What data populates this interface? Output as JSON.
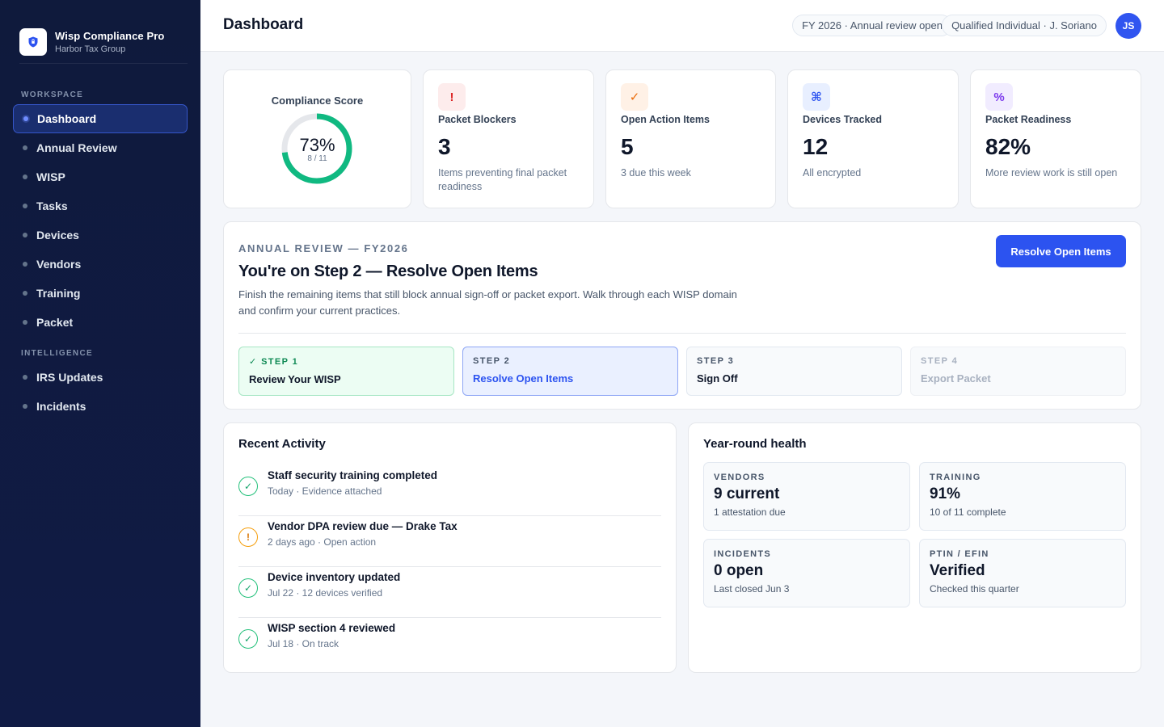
{
  "brand": {
    "name": "Wisp Compliance Pro",
    "org": "Harbor Tax Group"
  },
  "sidebar": {
    "workspace_label": "WORKSPACE",
    "intelligence_label": "INTELLIGENCE",
    "items": [
      {
        "label": "Dashboard",
        "active": true
      },
      {
        "label": "Annual Review"
      },
      {
        "label": "WISP"
      },
      {
        "label": "Tasks"
      },
      {
        "label": "Devices"
      },
      {
        "label": "Vendors"
      },
      {
        "label": "Training"
      },
      {
        "label": "Packet"
      }
    ],
    "intel_items": [
      {
        "label": "IRS Updates"
      },
      {
        "label": "Incidents"
      }
    ]
  },
  "header": {
    "title": "Dashboard",
    "fy_pill": "FY 2026 · Annual review open",
    "qi_pill": "Qualified Individual · J. Soriano",
    "avatar_initials": "JS"
  },
  "score": {
    "title": "Compliance Score",
    "percent_label": "73%",
    "fraction_label": "8 / 11",
    "value": 0.73,
    "color": "#10b981"
  },
  "stats": [
    {
      "icon": "!",
      "icon_name": "alert-icon",
      "label": "Packet Blockers",
      "value": "3",
      "note": "Items preventing final packet readiness"
    },
    {
      "icon": "✓",
      "icon_name": "check-icon",
      "label": "Open Action Items",
      "value": "5",
      "note": "3 due this week"
    },
    {
      "icon": "⌘",
      "icon_name": "device-icon",
      "label": "Devices Tracked",
      "value": "12",
      "note": "All encrypted"
    },
    {
      "icon": "%",
      "icon_name": "percent-icon",
      "label": "Packet Readiness",
      "value": "82%",
      "note": "More review work is still open"
    }
  ],
  "annual_review": {
    "eyebrow": "ANNUAL REVIEW — FY2026",
    "title": "You're on Step 2 — Resolve Open Items",
    "description": "Finish the remaining items that still block annual sign-off or packet export. Walk through each WISP domain and confirm your current practices.",
    "button": "Resolve Open Items",
    "steps": [
      {
        "label": "✓ STEP 1",
        "name": "Review Your WISP",
        "state": "done"
      },
      {
        "label": "STEP 2",
        "name": "Resolve Open Items",
        "state": "current"
      },
      {
        "label": "STEP 3",
        "name": "Sign Off",
        "state": "future"
      },
      {
        "label": "STEP 4",
        "name": "Export Packet",
        "state": "locked"
      }
    ]
  },
  "activity": {
    "title": "Recent Activity",
    "items": [
      {
        "title": "Staff security training completed",
        "meta": "Today · Evidence attached",
        "status": "done",
        "glyph": "✓"
      },
      {
        "title": "Vendor DPA review due — Drake Tax",
        "meta": "2 days ago · Open action",
        "status": "warn",
        "glyph": "!"
      },
      {
        "title": "Device inventory updated",
        "meta": "Jul 22 · 12 devices verified",
        "status": "done",
        "glyph": "✓"
      },
      {
        "title": "WISP section 4 reviewed",
        "meta": "Jul 18 · On track",
        "status": "done",
        "glyph": "✓"
      }
    ]
  },
  "health": {
    "title": "Year-round health",
    "tiles": [
      {
        "label": "VENDORS",
        "value": "9 current",
        "note": "1 attestation due"
      },
      {
        "label": "TRAINING",
        "value": "91%",
        "note": "10 of 11 complete"
      },
      {
        "label": "INCIDENTS",
        "value": "0 open",
        "note": "Last closed Jun 3"
      },
      {
        "label": "PTIN / EFIN",
        "value": "Verified",
        "note": "Checked this quarter"
      }
    ]
  }
}
